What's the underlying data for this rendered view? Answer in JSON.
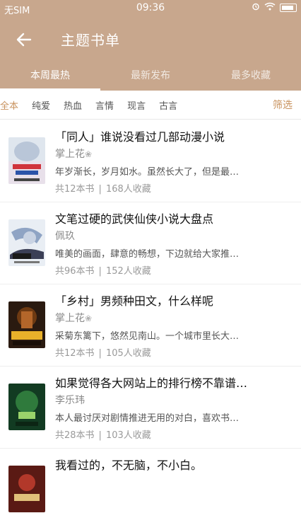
{
  "status_bar": {
    "carrier": "无SIM",
    "time": "09:36"
  },
  "header": {
    "title": "主题书单",
    "back_icon": "arrow-left-icon"
  },
  "tabs": [
    {
      "label": "本周最热",
      "active": true
    },
    {
      "label": "最新发布",
      "active": false
    },
    {
      "label": "最多收藏",
      "active": false
    }
  ],
  "filters": {
    "items": [
      {
        "label": "全本",
        "active": true
      },
      {
        "label": "纯爱",
        "active": false
      },
      {
        "label": "热血",
        "active": false
      },
      {
        "label": "言情",
        "active": false
      },
      {
        "label": "现言",
        "active": false
      },
      {
        "label": "古言",
        "active": false
      }
    ],
    "filter_button": "筛选"
  },
  "booklists": [
    {
      "title": "「同人」谁说没看过几部动漫小说",
      "author": "掌上花",
      "author_badge": "❀",
      "description": "年岁渐长，岁月如水。虽然长大了，但是最…",
      "book_count": "共12本书",
      "favorites": "168人收藏"
    },
    {
      "title": "文笔过硬的武侠仙侠小说大盘点",
      "author": "佩玖",
      "author_badge": "",
      "description": "唯美的画面，肆意的畅想，下边就给大家推…",
      "book_count": "共96本书",
      "favorites": "152人收藏"
    },
    {
      "title": "「乡村」男频种田文，什么样呢",
      "author": "掌上花",
      "author_badge": "❀",
      "description": "采菊东篱下，悠然见南山。一个城市里长大…",
      "book_count": "共12本书",
      "favorites": "105人收藏"
    },
    {
      "title": "如果觉得各大网站上的排行榜不靠谱…",
      "author": "李乐玮",
      "author_badge": "",
      "description": "本人最讨厌对剧情推进无用的对白，喜欢书…",
      "book_count": "共28本书",
      "favorites": "103人收藏"
    },
    {
      "title": "我看过的，不无脑，不小白。",
      "author": "",
      "author_badge": "",
      "description": "",
      "book_count": "",
      "favorites": ""
    }
  ],
  "colors": {
    "brand": "#c8a78d",
    "accent": "#c8925e"
  }
}
